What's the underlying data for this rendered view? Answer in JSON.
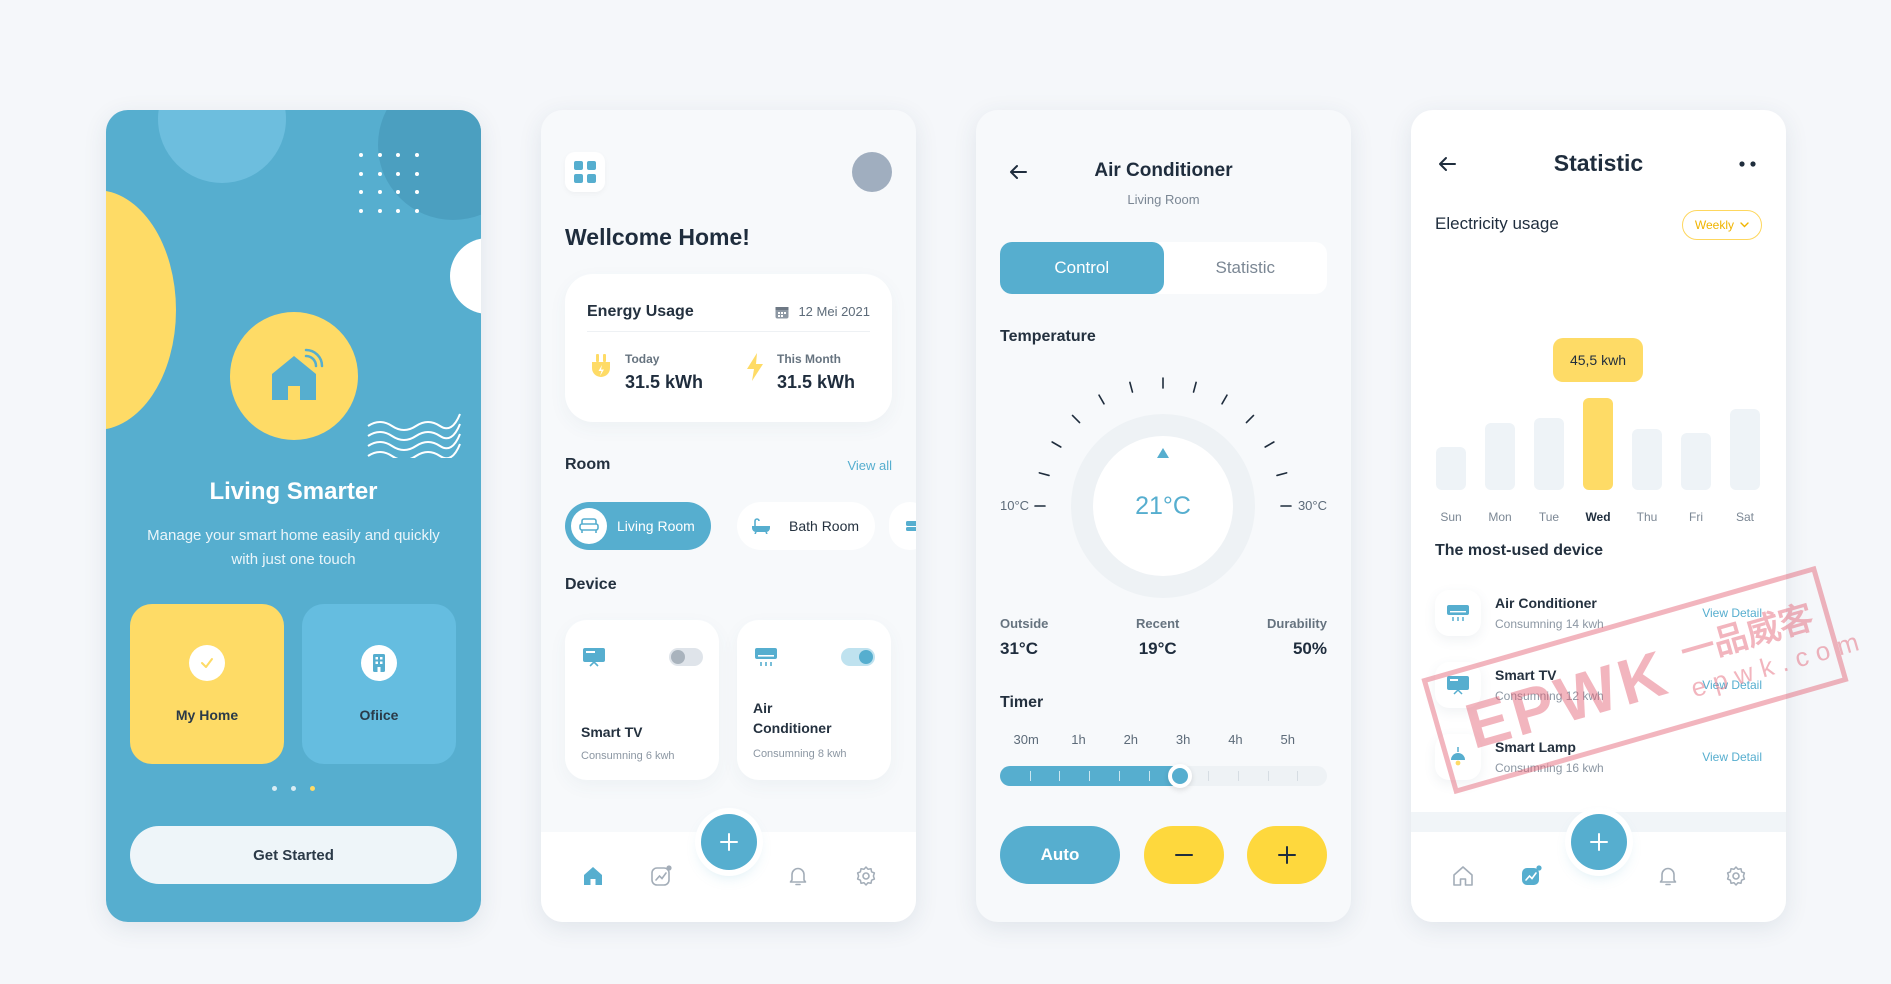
{
  "onboarding": {
    "title": "Living Smarter",
    "description": "Manage your smart home easily and quickly with just one touch",
    "mode_home": "My Home",
    "mode_office": "Ofiice",
    "cta": "Get Started",
    "colors": {
      "primary": "#56aecf",
      "accent": "#fedb66"
    }
  },
  "home": {
    "welcome": "Wellcome Home!",
    "energy": {
      "title": "Energy Usage",
      "date": "12 Mei 2021",
      "today_label": "Today",
      "today_value": "31.5 kWh",
      "month_label": "This Month",
      "month_value": "31.5 kWh"
    },
    "room_title": "Room",
    "view_all": "View all",
    "rooms": [
      {
        "label": "Living Room",
        "icon": "sofa-icon",
        "active": true
      },
      {
        "label": "Bath Room",
        "icon": "bathtub-icon",
        "active": false
      }
    ],
    "device_title": "Device",
    "devices": [
      {
        "name": "Smart TV",
        "consumption": "Consumning 6 kwh",
        "on": false
      },
      {
        "name": "Air Conditioner",
        "consumption": "Consumning 8 kwh",
        "on": true
      }
    ]
  },
  "control": {
    "title": "Air Conditioner",
    "subtitle": "Living Room",
    "tab_active": "Control",
    "tab_inactive": "Statistic",
    "temperature_title": "Temperature",
    "temp_value": "21°C",
    "temp_min": "10°C",
    "temp_max": "30°C",
    "readings": [
      {
        "label": "Outside",
        "value": "31°C"
      },
      {
        "label": "Recent",
        "value": "19°C"
      },
      {
        "label": "Durability",
        "value": "50%"
      }
    ],
    "timer_title": "Timer",
    "timer_labels": [
      "30m",
      "1h",
      "2h",
      "3h",
      "4h",
      "5h"
    ],
    "timer_level": 0.55,
    "auto_label": "Auto"
  },
  "statistic": {
    "title": "Statistic",
    "usage_title": "Electricity usage",
    "period": "Weekly",
    "tooltip": "45,5 kwh",
    "days": [
      "Sun",
      "Mon",
      "Tue",
      "Wed",
      "Thu",
      "Fri",
      "Sat"
    ],
    "highlight_day": "Wed",
    "most_used_title": "The most-used device",
    "devices": [
      {
        "name": "Air Conditioner",
        "consumption": "Consumning 14 kwh",
        "action": "View Detail"
      },
      {
        "name": "Smart TV",
        "consumption": "Consumning 12 kwh",
        "action": "View Detail"
      },
      {
        "name": "Smart Lamp",
        "consumption": "Consumning 16 kwh",
        "action": "View Detail"
      }
    ]
  },
  "watermark": {
    "logo": "EPWK",
    "chinese": "一品威客",
    "domain": "epwk.com"
  }
}
